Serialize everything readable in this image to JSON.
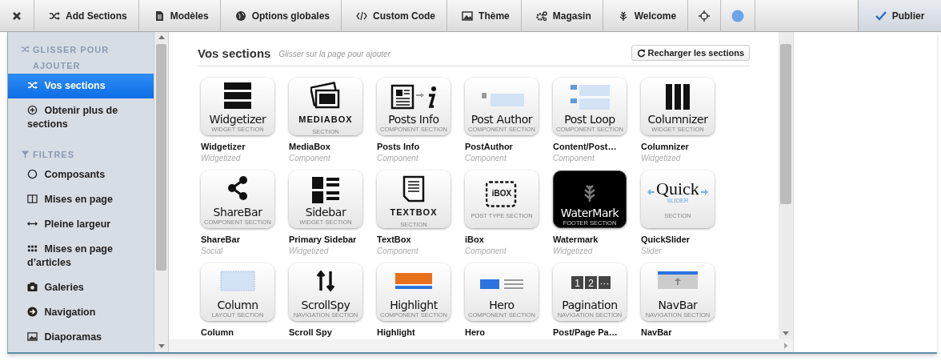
{
  "toolbar": {
    "items": [
      {
        "kind": "icon"
      },
      {
        "kind": "text",
        "label": "Add Sections"
      },
      {
        "kind": "text",
        "label": "Modèles"
      },
      {
        "kind": "text",
        "label": "Options globales"
      },
      {
        "kind": "text",
        "label": "Custom Code"
      },
      {
        "kind": "text",
        "label": "Thème"
      },
      {
        "kind": "text",
        "label": "Magasin"
      },
      {
        "kind": "text",
        "label": "Welcome"
      },
      {
        "kind": "icon"
      },
      {
        "kind": "icon"
      }
    ],
    "publish": {
      "label": "Publier"
    }
  },
  "sidebar": {
    "items": [
      {
        "kind": "heading",
        "label": "GLISSER POUR AJOUTER"
      },
      {
        "kind": "item",
        "label": "Vos sections",
        "selected": true
      },
      {
        "kind": "item",
        "label": "Obtenir plus de sections",
        "selected": false
      },
      {
        "kind": "heading",
        "label": "FILTRES"
      },
      {
        "kind": "item",
        "label": "Composants",
        "selected": false
      },
      {
        "kind": "item",
        "label": "Mises en page",
        "selected": false
      },
      {
        "kind": "item",
        "label": "Pleine largeur",
        "selected": false
      },
      {
        "kind": "item",
        "label": "Mises en page d’articles",
        "selected": false
      },
      {
        "kind": "item",
        "label": "Galeries",
        "selected": false
      },
      {
        "kind": "item",
        "label": "Navigation",
        "selected": false
      },
      {
        "kind": "item",
        "label": "Diaporamas",
        "selected": false
      }
    ]
  },
  "main": {
    "title": "Vos sections",
    "hint": "Glisser sur la page pour ajouter",
    "reload": "Recharger les sections",
    "sections": [
      {
        "kind": "stack",
        "title": "Widgetizer",
        "caption": "WIDGET SECTION",
        "name": "Widgetizer",
        "type": "Widgetized"
      },
      {
        "kind": "photos",
        "title": "MEDIABOX",
        "caption": "SECTION",
        "name": "MediaBox",
        "type": "Component"
      },
      {
        "kind": "posts",
        "title": "Posts Info",
        "caption": "COMPONENT SECTION",
        "name": "Posts Info",
        "type": "Component"
      },
      {
        "kind": "author",
        "title": "Post Author",
        "caption": "COMPONENT SECTION",
        "name": "PostAuthor",
        "type": "Component"
      },
      {
        "kind": "loop",
        "title": "Post Loop",
        "caption": "COMPONENT SECTION",
        "name": "Content/Post…",
        "type": "Component"
      },
      {
        "kind": "columns",
        "title": "Columnizer",
        "caption": "WIDGET SECTION",
        "name": "Columnizer",
        "type": "Widgetized"
      },
      {
        "kind": "share",
        "title": "ShareBar",
        "caption": "COMPONENT SECTION",
        "name": "ShareBar",
        "type": "Social"
      },
      {
        "kind": "sidebar",
        "title": "Sidebar",
        "caption": "WIDGET SECTION",
        "name": "Primary Sidebar",
        "type": "Widgetized"
      },
      {
        "kind": "textbox",
        "title": "TEXTBOX",
        "caption": "SECTION",
        "name": "TextBox",
        "type": "Component"
      },
      {
        "kind": "ibox",
        "title": "iBOX",
        "caption": "POST TYPE SECTION",
        "name": "iBox",
        "type": "Component"
      },
      {
        "kind": "watermark",
        "title": "WaterMark",
        "caption": "FOOTER SECTION",
        "name": "Watermark",
        "type": "Widgetized"
      },
      {
        "kind": "slider",
        "title": "Quick",
        "sub": "SLIDER",
        "caption": "SECTION",
        "name": "QuickSlider",
        "type": "Slider"
      },
      {
        "kind": "column",
        "title": "Column",
        "caption": "LAYOUT SECTION",
        "name": "Column"
      },
      {
        "kind": "scrollspy",
        "title": "ScrollSpy",
        "caption": "NAVIGATION SECTION",
        "name": "Scroll Spy"
      },
      {
        "kind": "highlight",
        "title": "Highlight",
        "caption": "COMPONENT SECTION",
        "name": "Highlight"
      },
      {
        "kind": "hero",
        "title": "Hero",
        "caption": "COMPONENT SECTION",
        "name": "Hero"
      },
      {
        "kind": "pagination",
        "title": "Pagination",
        "caption": "NAVIGATION SECTION",
        "name": "Post/Page Pa…",
        "digits": [
          "1",
          "2",
          "···"
        ]
      },
      {
        "kind": "navbar",
        "title": "NavBar",
        "caption": "NAVIGATION SECTION",
        "name": "NavBar"
      }
    ]
  }
}
